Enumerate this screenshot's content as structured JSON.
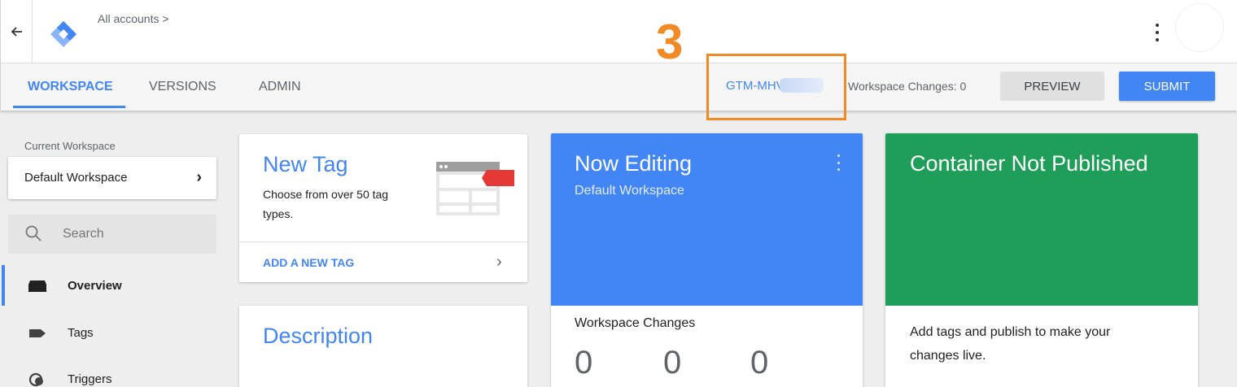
{
  "header": {
    "back_icon": "arrow-left-icon",
    "logo_icon": "gtm-diamond-logo",
    "breadcrumb": "All accounts >",
    "annotation_number": "3",
    "more_icon": "vertical-dots-icon"
  },
  "nav": {
    "tabs": [
      {
        "label": "WORKSPACE",
        "active": true
      },
      {
        "label": "VERSIONS",
        "active": false
      },
      {
        "label": "ADMIN",
        "active": false
      }
    ],
    "container_id": "GTM-MHV",
    "workspace_changes": "Workspace Changes: 0",
    "preview_label": "PREVIEW",
    "submit_label": "SUBMIT"
  },
  "sidebar": {
    "current_workspace_label": "Current Workspace",
    "workspace_name": "Default Workspace",
    "search_placeholder": "Search",
    "items": [
      {
        "label": "Overview",
        "icon": "overview-icon",
        "active": true
      },
      {
        "label": "Tags",
        "icon": "tag-icon",
        "active": false
      },
      {
        "label": "Triggers",
        "icon": "trigger-icon",
        "active": false
      }
    ]
  },
  "cards": {
    "new_tag": {
      "title": "New Tag",
      "description": "Choose from over 50 tag types.",
      "link": "ADD A NEW TAG"
    },
    "description": {
      "title": "Description"
    },
    "now_editing": {
      "title": "Now Editing",
      "subtitle": "Default Workspace",
      "changes_title": "Workspace Changes",
      "counts": [
        "0",
        "0",
        "0"
      ]
    },
    "published": {
      "title": "Container Not Published",
      "description": "Add tags and publish to make your changes live."
    }
  },
  "colors": {
    "accent_blue": "#4285f4",
    "published_green": "#1e9e58",
    "annotation_orange": "#f08a24"
  }
}
